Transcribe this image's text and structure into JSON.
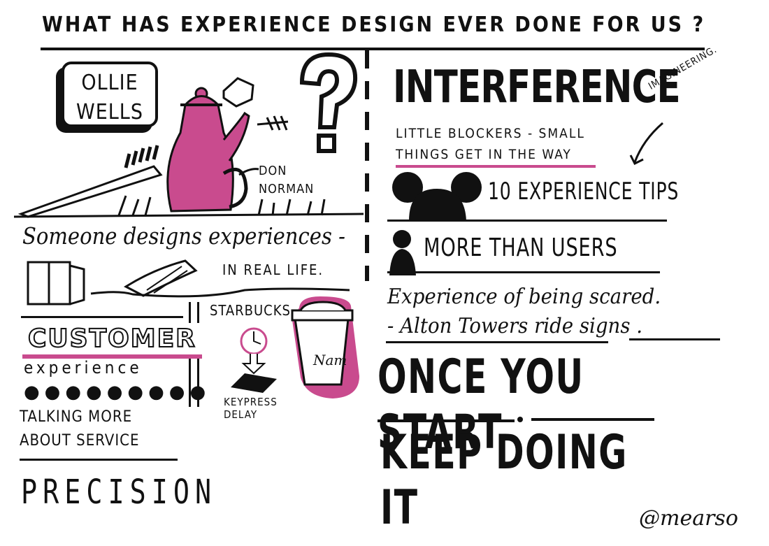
{
  "title": "WHAT HAS EXPERIENCE DESIGN EVER DONE FOR US ?",
  "speaker": {
    "line1": "OLLIE",
    "line2": "WELLS"
  },
  "don_norman": {
    "line1": "DON",
    "line2": "NORMAN"
  },
  "someone": "Someone designs experiences -",
  "in_real_life": "IN REAL LIFE.",
  "customer": {
    "word": "CUSTOMER",
    "sub": "experience",
    "dots": "●●●●●●●●●"
  },
  "talking": {
    "line1": "TALKING MORE",
    "line2": "ABOUT SERVICE"
  },
  "precision": "PRECISION",
  "starbucks": "STARBUCKS",
  "keypress": {
    "line1": "KEYPRESS",
    "line2": "DELAY"
  },
  "interference": "INTERFERENCE",
  "blockers": {
    "line1": "LITTLE BLOCKERS - SMALL",
    "line2": "THINGS GET IN THE WAY"
  },
  "imagineering": "IMAGINEERING.",
  "tips": "10 EXPERIENCE TIPS",
  "users": "MORE THAN USERS",
  "scared": {
    "line1": "Experience of being scared.",
    "line2": "- Alton Towers ride signs ."
  },
  "once": "ONCE YOU START",
  "keep": "KEEP DOING IT",
  "handle": "@mearso",
  "colors": {
    "pink": "#c94b8e",
    "ink": "#111111"
  }
}
